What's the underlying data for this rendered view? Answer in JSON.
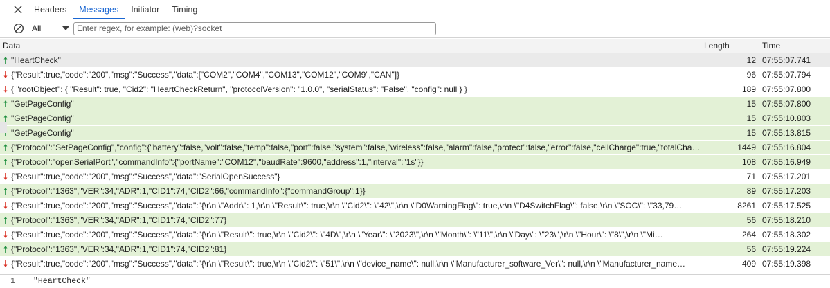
{
  "tabs": [
    {
      "label": "Headers",
      "active": false
    },
    {
      "label": "Messages",
      "active": true
    },
    {
      "label": "Initiator",
      "active": false
    },
    {
      "label": "Timing",
      "active": false
    }
  ],
  "filter": {
    "type_value": "All",
    "search_placeholder": "Enter regex, for example: (web)?socket"
  },
  "table": {
    "headers": {
      "data": "Data",
      "length": "Length",
      "time": "Time"
    },
    "rows": [
      {
        "dir": "sent",
        "selected": true,
        "data": "\"HeartCheck\"",
        "length": "12",
        "time": "07:55:07.741"
      },
      {
        "dir": "recv",
        "data": "{\"Result\":true,\"code\":\"200\",\"msg\":\"Success\",\"data\":[\"COM2\",\"COM4\",\"COM13\",\"COM12\",\"COM9\",\"CAN\"]}",
        "length": "96",
        "time": "07:55:07.794"
      },
      {
        "dir": "recv",
        "data": "{ \"rootObject\": { \"Result\": true, \"Cid2\": \"HeartCheckReturn\", \"protocolVersion\": \"1.0.0\", \"serialStatus\": \"False\", \"config\": null } }",
        "length": "189",
        "time": "07:55:07.800"
      },
      {
        "dir": "sent",
        "data": "\"GetPageConfig\"",
        "length": "15",
        "time": "07:55:07.800"
      },
      {
        "dir": "sent",
        "data": "\"GetPageConfig\"",
        "length": "15",
        "time": "07:55:10.803"
      },
      {
        "dir": "sent",
        "data": "\"GetPageConfig\"",
        "length": "15",
        "time": "07:55:13.815"
      },
      {
        "dir": "sent",
        "data": "{\"Protocol\":\"SetPageConfig\",\"config\":{\"battery\":false,\"volt\":false,\"temp\":false,\"port\":false,\"system\":false,\"wireless\":false,\"alarm\":false,\"protect\":false,\"error\":false,\"cellCharge\":true,\"totalChar…",
        "length": "1449",
        "time": "07:55:16.804"
      },
      {
        "dir": "sent",
        "data": "{\"Protocol\":\"openSerialPort\",\"commandInfo\":{\"portName\":\"COM12\",\"baudRate\":9600,\"address\":1,\"interval\":\"1s\"}}",
        "length": "108",
        "time": "07:55:16.949"
      },
      {
        "dir": "recv",
        "data": "{\"Result\":true,\"code\":\"200\",\"msg\":\"Success\",\"data\":\"SerialOpenSuccess\"}",
        "length": "71",
        "time": "07:55:17.201"
      },
      {
        "dir": "sent",
        "data": "{\"Protocol\":\"1363\",\"VER\":34,\"ADR\":1,\"CID1\":74,\"CID2\":66,\"commandInfo\":{\"commandGroup\":1}}",
        "length": "89",
        "time": "07:55:17.203"
      },
      {
        "dir": "recv",
        "data": "{\"Result\":true,\"code\":\"200\",\"msg\":\"Success\",\"data\":\"{\\r\\n \\\"Addr\\\": 1,\\r\\n \\\"Result\\\": true,\\r\\n \\\"Cid2\\\": \\\"42\\\",\\r\\n \\\"D0WarningFlag\\\": true,\\r\\n \\\"D4SwitchFlag\\\": false,\\r\\n \\\"SOC\\\": \\\"33,79…",
        "length": "8261",
        "time": "07:55:17.525"
      },
      {
        "dir": "sent",
        "data": "{\"Protocol\":\"1363\",\"VER\":34,\"ADR\":1,\"CID1\":74,\"CID2\":77}",
        "length": "56",
        "time": "07:55:18.210"
      },
      {
        "dir": "recv",
        "data": "{\"Result\":true,\"code\":\"200\",\"msg\":\"Success\",\"data\":\"{\\r\\n \\\"Result\\\": true,\\r\\n \\\"Cid2\\\": \\\"4D\\\",\\r\\n \\\"Year\\\": \\\"2023\\\",\\r\\n \\\"Month\\\": \\\"11\\\",\\r\\n \\\"Day\\\": \\\"23\\\",\\r\\n \\\"Hour\\\": \\\"8\\\",\\r\\n \\\"Mi…",
        "length": "264",
        "time": "07:55:18.302"
      },
      {
        "dir": "sent",
        "data": "{\"Protocol\":\"1363\",\"VER\":34,\"ADR\":1,\"CID1\":74,\"CID2\":81}",
        "length": "56",
        "time": "07:55:19.224"
      },
      {
        "dir": "recv",
        "data": "{\"Result\":true,\"code\":\"200\",\"msg\":\"Success\",\"data\":\"{\\r\\n \\\"Result\\\": true,\\r\\n \\\"Cid2\\\": \\\"51\\\",\\r\\n \\\"device_name\\\": null,\\r\\n \\\"Manufacturer_software_Ver\\\": null,\\r\\n \\\"Manufacturer_name…",
        "length": "409",
        "time": "07:55:19.398"
      }
    ]
  },
  "preview": {
    "line_number": "1",
    "content": "\"HeartCheck\""
  },
  "colors": {
    "sent_arrow": "#1e8e3e",
    "recv_arrow": "#d93025",
    "accent": "#1a66d2",
    "sent_row_bg": "#e3f1d6"
  }
}
